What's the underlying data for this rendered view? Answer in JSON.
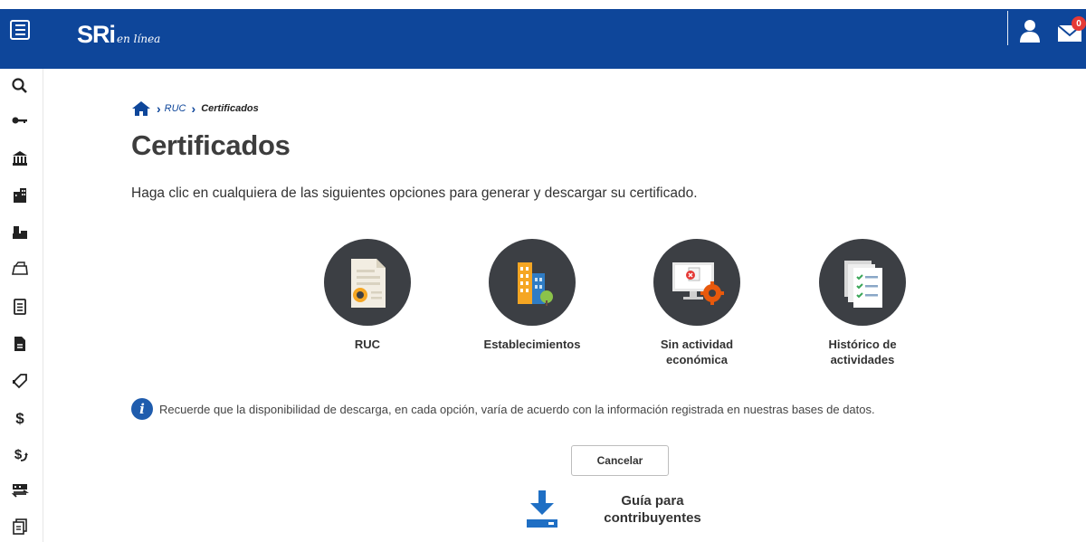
{
  "header": {
    "logo_main": "SRi",
    "logo_sub": "en línea",
    "notifications_count": "0"
  },
  "sidebar": {
    "items": [
      {
        "icon": "search-icon"
      },
      {
        "icon": "key-icon"
      },
      {
        "icon": "bank-icon"
      },
      {
        "icon": "buildings-icon"
      },
      {
        "icon": "factory-icon"
      },
      {
        "icon": "folder-icon"
      },
      {
        "icon": "document-list-icon"
      },
      {
        "icon": "document-filled-icon"
      },
      {
        "icon": "tag-icon"
      },
      {
        "icon": "dollar-icon"
      },
      {
        "icon": "dollar-return-icon"
      },
      {
        "icon": "transfer-icon"
      },
      {
        "icon": "documents-icon"
      }
    ]
  },
  "breadcrumb": {
    "home_icon": "home-icon",
    "link": "RUC",
    "current": "Certificados"
  },
  "page": {
    "title": "Certificados",
    "intro": "Haga clic en cualquiera de las siguientes opciones para generar y descargar su certificado."
  },
  "options": [
    {
      "label": "RUC",
      "icon": "certificate-icon"
    },
    {
      "label": "Establecimientos",
      "icon": "buildings-icon"
    },
    {
      "label": "Sin actividad económica",
      "icon": "monitor-gear-icon"
    },
    {
      "label": "Histórico de actividades",
      "icon": "checklist-icon"
    }
  ],
  "info": {
    "icon": "info-icon",
    "text": "Recuerde que la disponibilidad de descarga, en cada opción, varía de acuerdo con la información registrada en nuestras bases de datos."
  },
  "actions": {
    "cancel_label": "Cancelar"
  },
  "guide": {
    "icon": "download-icon",
    "label": "Guía para contribuyentes"
  },
  "colors": {
    "brand": "#0e469a",
    "circle": "#3c3f44",
    "badge": "#e53935"
  }
}
